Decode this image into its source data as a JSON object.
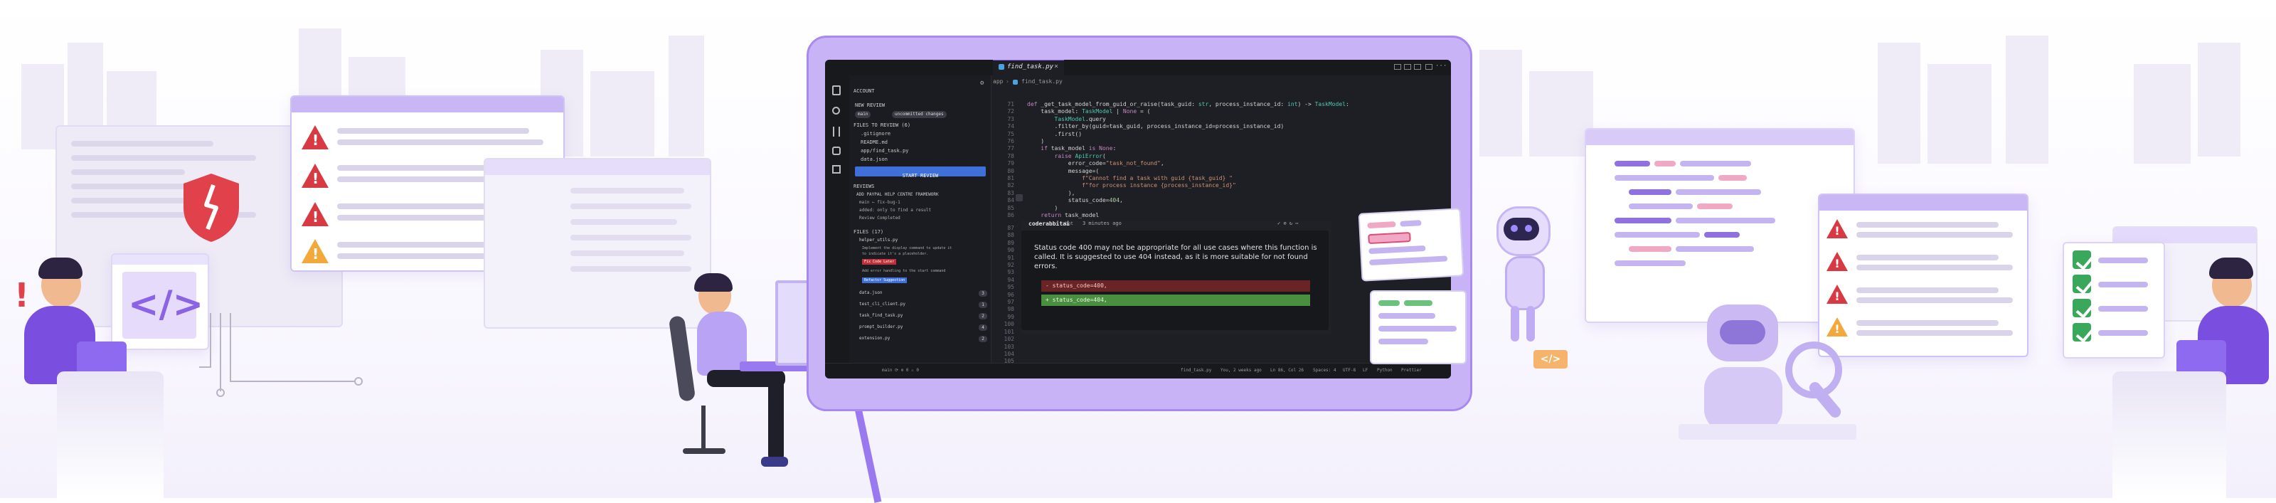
{
  "ide": {
    "tab_filename": "find_task.py",
    "breadcrumb_dir": "app",
    "breadcrumb_file": "find_task.py",
    "sidebar": {
      "account": "ACCOUNT",
      "new_review": "NEW REVIEW",
      "chip_branch": "main",
      "chip_changes": "uncommitted changes",
      "files_to_review": "FILES TO REVIEW (6)",
      "files": [
        ".gitignore",
        "README.md",
        "app/find_task.py",
        "data.json"
      ],
      "start_review": "START REVIEW",
      "reviews": "REVIEWS",
      "review_title": "ADD PAYPAL HELP CENTRE FRAMEWORK",
      "review_items": [
        "main ← fix-bug-1",
        "added: only to find a result",
        "Review Completed"
      ],
      "files_count": "FILES (17)",
      "issue_file": "helper_utils.py",
      "issue_lines": [
        "Implement the display command to update it",
        "to indicate it's a placeholder."
      ],
      "badge_red": "Fix Code Later",
      "issue_line2": "Add error handling to the start command",
      "badge_blue": "Refactor Suggestion",
      "files_list": [
        "data.json",
        "test_cli_client.py",
        "task_find_task.py",
        "prompt_builder.py",
        "extension.py"
      ],
      "files_counts": [
        "3",
        "1",
        "2",
        "4",
        "2"
      ]
    },
    "line_numbers_top": [
      "71",
      "72",
      "73",
      "74",
      "75",
      "76",
      "77",
      "78",
      "79",
      "80",
      "81",
      "82",
      "83",
      "84",
      "85",
      "86"
    ],
    "code_lines": [
      "def _get_task_model_from_guid_or_raise(task_guid: str, process_instance_id: int) -> TaskModel:",
      "    task_model: TaskModel | None = (",
      "        TaskModel.query",
      "        .filter_by(guid=task_guid, process_instance_id=process_instance_id)",
      "        .first()",
      "    )",
      "    if task_model is None:",
      "        raise ApiError(",
      "            error_code=\"task_not_found\",",
      "            message=(",
      "                f\"Cannot find a task with guid {task_guid} \"",
      "                f\"for process instance {process_instance_id}\"",
      "            ),",
      "            status_code=404,",
      "        )",
      "    return task_model"
    ],
    "comment_user": "coderabbitai",
    "comment_badge": "bot",
    "comment_time": "3 minutes ago",
    "comment_text": "Status code 400 may not be appropriate for all use cases where this function is called. It is suggested to use 404 instead, as it is more suitable for not found errors.",
    "diff_removed": "- status_code=400,",
    "diff_added": "+ status_code=404,",
    "line_numbers_bottom": [
      "87",
      "88",
      "89",
      "90",
      "91",
      "92",
      "93",
      "94",
      "95",
      "96",
      "97",
      "98",
      "99",
      "100",
      "101",
      "102",
      "103",
      "104",
      "105",
      "106",
      "107"
    ],
    "status_left": "main  ⟳  ⊗ 0 ⚠ 0",
    "status_items": [
      "find_task.py",
      "You, 2 weeks ago",
      "Ln 86, Col 26",
      "Spaces: 4",
      "UTF-8",
      "LF",
      "Python",
      "Prettier"
    ]
  },
  "colors": {
    "accent": "#8a63e6",
    "ide_bg": "#1e1f24",
    "warning_red": "#d83a44",
    "warning_yellow": "#f2a83b",
    "check_green": "#3aa85a",
    "frame_purple": "#c8b3f6"
  },
  "icons": [
    "warning-icon",
    "shield-broken-icon",
    "code-brackets-icon",
    "checkmark-icon",
    "alert-exclamation-icon",
    "files-icon",
    "search-icon",
    "git-icon",
    "extensions-icon",
    "robot-icon"
  ]
}
